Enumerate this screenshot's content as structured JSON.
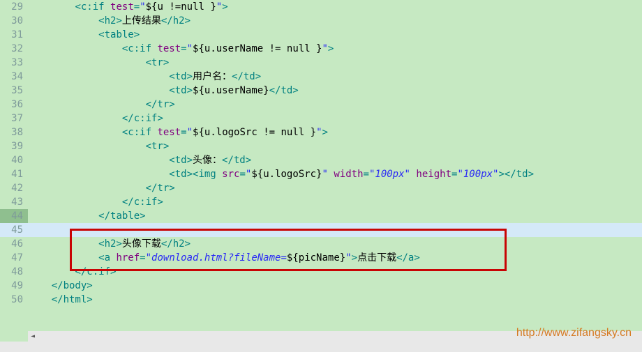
{
  "watermark": "http://www.zifangsky.cn",
  "lines": [
    {
      "n": 29,
      "indent": "        ",
      "tokens": [
        [
          "tag",
          "<"
        ],
        [
          "ns",
          "c:if"
        ],
        [
          "txt",
          " "
        ],
        [
          "attr",
          "test"
        ],
        [
          "tag",
          "="
        ],
        [
          "str",
          "\""
        ],
        [
          "expr",
          "${u !=null }"
        ],
        [
          "str",
          "\""
        ],
        [
          "tag",
          ">"
        ]
      ]
    },
    {
      "n": 30,
      "indent": "            ",
      "tokens": [
        [
          "tag",
          "<h2>"
        ],
        [
          "txt",
          "上传结果"
        ],
        [
          "tag",
          "</h2>"
        ]
      ]
    },
    {
      "n": 31,
      "indent": "            ",
      "tokens": [
        [
          "tag",
          "<table>"
        ]
      ]
    },
    {
      "n": 32,
      "indent": "                ",
      "tokens": [
        [
          "tag",
          "<"
        ],
        [
          "ns",
          "c:if"
        ],
        [
          "txt",
          " "
        ],
        [
          "attr",
          "test"
        ],
        [
          "tag",
          "="
        ],
        [
          "str",
          "\""
        ],
        [
          "expr",
          "${u.userName != null }"
        ],
        [
          "str",
          "\""
        ],
        [
          "tag",
          ">"
        ]
      ]
    },
    {
      "n": 33,
      "indent": "                    ",
      "tokens": [
        [
          "tag",
          "<tr>"
        ]
      ]
    },
    {
      "n": 34,
      "indent": "                        ",
      "tokens": [
        [
          "tag",
          "<td>"
        ],
        [
          "txt",
          "用户名："
        ],
        [
          "tag",
          "</td>"
        ]
      ]
    },
    {
      "n": 35,
      "indent": "                        ",
      "tokens": [
        [
          "tag",
          "<td>"
        ],
        [
          "expr",
          "${u.userName}"
        ],
        [
          "tag",
          "</td>"
        ]
      ]
    },
    {
      "n": 36,
      "indent": "                    ",
      "tokens": [
        [
          "tag",
          "</tr>"
        ]
      ]
    },
    {
      "n": 37,
      "indent": "                ",
      "tokens": [
        [
          "tag",
          "</"
        ],
        [
          "ns",
          "c:if"
        ],
        [
          "tag",
          ">"
        ]
      ]
    },
    {
      "n": 38,
      "indent": "                ",
      "tokens": [
        [
          "tag",
          "<"
        ],
        [
          "ns",
          "c:if"
        ],
        [
          "txt",
          " "
        ],
        [
          "attr",
          "test"
        ],
        [
          "tag",
          "="
        ],
        [
          "str",
          "\""
        ],
        [
          "expr",
          "${u.logoSrc != null }"
        ],
        [
          "str",
          "\""
        ],
        [
          "tag",
          ">"
        ]
      ]
    },
    {
      "n": 39,
      "indent": "                    ",
      "tokens": [
        [
          "tag",
          "<tr>"
        ]
      ]
    },
    {
      "n": 40,
      "indent": "                        ",
      "tokens": [
        [
          "tag",
          "<td>"
        ],
        [
          "txt",
          "头像："
        ],
        [
          "tag",
          "</td>"
        ]
      ]
    },
    {
      "n": 41,
      "indent": "                        ",
      "tokens": [
        [
          "tag",
          "<td><img"
        ],
        [
          "txt",
          " "
        ],
        [
          "attr",
          "src"
        ],
        [
          "tag",
          "="
        ],
        [
          "str",
          "\""
        ],
        [
          "expr",
          "${u.logoSrc}"
        ],
        [
          "str",
          "\""
        ],
        [
          "txt",
          " "
        ],
        [
          "attr",
          "width"
        ],
        [
          "tag",
          "="
        ],
        [
          "strit",
          "\"100px\""
        ],
        [
          "txt",
          " "
        ],
        [
          "attr",
          "height"
        ],
        [
          "tag",
          "="
        ],
        [
          "strit",
          "\"100px\""
        ],
        [
          "tag",
          "></td>"
        ]
      ]
    },
    {
      "n": 42,
      "indent": "                    ",
      "tokens": [
        [
          "tag",
          "</tr>"
        ]
      ]
    },
    {
      "n": 43,
      "indent": "                ",
      "tokens": [
        [
          "tag",
          "</"
        ],
        [
          "ns",
          "c:if"
        ],
        [
          "tag",
          ">"
        ]
      ]
    },
    {
      "n": 44,
      "indent": "            ",
      "tokens": [
        [
          "tag",
          "</table>"
        ]
      ],
      "hl": true
    },
    {
      "n": 45,
      "indent": "",
      "tokens": [],
      "current": true
    },
    {
      "n": 46,
      "indent": "            ",
      "tokens": [
        [
          "tag",
          "<h2>"
        ],
        [
          "txt",
          "头像下载"
        ],
        [
          "tag",
          "</h2>"
        ]
      ]
    },
    {
      "n": 47,
      "indent": "            ",
      "tokens": [
        [
          "tag",
          "<a"
        ],
        [
          "txt",
          " "
        ],
        [
          "attr",
          "href"
        ],
        [
          "tag",
          "="
        ],
        [
          "strit",
          "\"download.html?fileName="
        ],
        [
          "expr",
          "${picName}"
        ],
        [
          "strit",
          "\""
        ],
        [
          "tag",
          ">"
        ],
        [
          "txt",
          "点击下载"
        ],
        [
          "tag",
          "</a>"
        ]
      ]
    },
    {
      "n": 48,
      "indent": "        ",
      "tokens": [
        [
          "tag",
          "</"
        ],
        [
          "ns",
          "c:if"
        ],
        [
          "tag",
          ">"
        ]
      ]
    },
    {
      "n": 49,
      "indent": "    ",
      "tokens": [
        [
          "tag",
          "</body>"
        ]
      ]
    },
    {
      "n": 50,
      "indent": "    ",
      "tokens": [
        [
          "tag",
          "</html>"
        ]
      ]
    }
  ]
}
